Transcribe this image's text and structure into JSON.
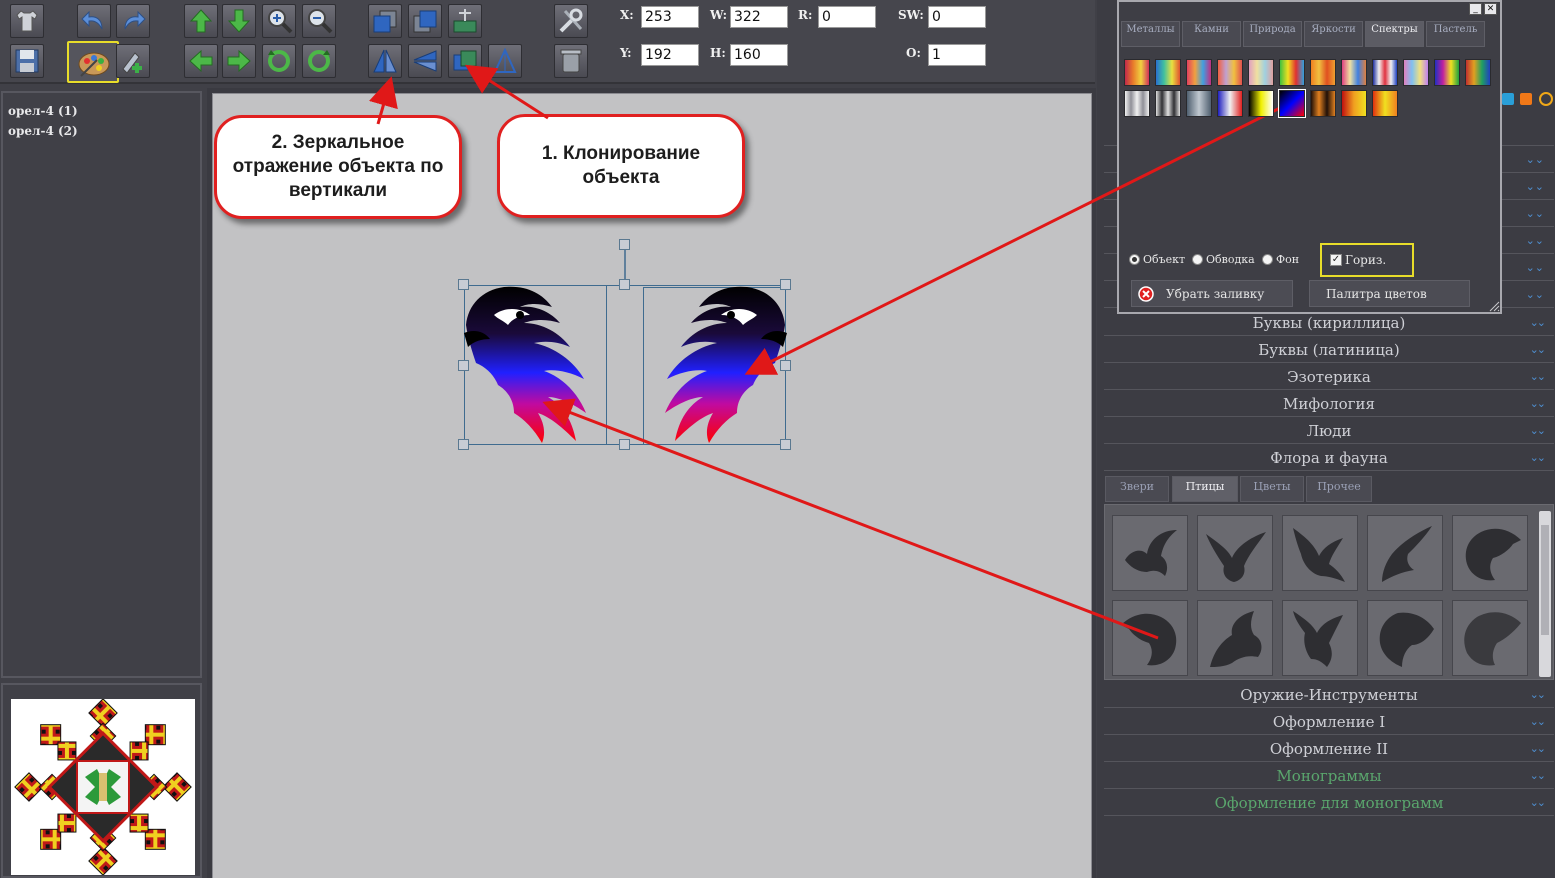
{
  "toolbar": {
    "x_label": "X:",
    "x_value": "253",
    "y_label": "Y:",
    "y_value": "192",
    "w_label": "W:",
    "w_value": "322",
    "h_label": "H:",
    "h_value": "160",
    "r_label": "R:",
    "r_value": "0",
    "sw_label": "SW:",
    "sw_value": "0",
    "o_label": "O:",
    "o_value": "1"
  },
  "layers": [
    "орел-4 (1)",
    "орел-4 (2)"
  ],
  "callouts": {
    "mirror": "2. Зеркальное отражение объекта по вертикали",
    "clone": "1. Клонирование объекта"
  },
  "fill_dialog": {
    "tabs": [
      "Металлы",
      "Камни",
      "Природа",
      "Яркости",
      "Спектры",
      "Пастель"
    ],
    "active_tab": "Спектры",
    "radio_object": "Объект",
    "radio_outline": "Обводка",
    "radio_background": "Фон",
    "horizontal_checkbox": "Гориз.",
    "remove_fill_button": "Убрать заливку",
    "palette_button": "Палитра цветов"
  },
  "categories_top": [
    "Буквы (кириллица)",
    "Буквы (латиница)",
    "Эзотерика",
    "Мифология",
    "Люди",
    "Флора и фауна"
  ],
  "bird_tabs": [
    "Звери",
    "Птицы",
    "Цветы",
    "Прочее"
  ],
  "active_bird_tab": "Птицы",
  "categories_bottom": [
    "Оружие-Инструменты",
    "Оформление I",
    "Оформление II"
  ],
  "categories_green": [
    "Монограммы",
    "Оформление для монограмм"
  ],
  "colors": {
    "accent_highlight": "#e8dd2a",
    "callout_border": "#e02020",
    "arrow": "#e01818",
    "category_green": "#5aa66d",
    "chevron_blue": "#4e8fd1"
  }
}
